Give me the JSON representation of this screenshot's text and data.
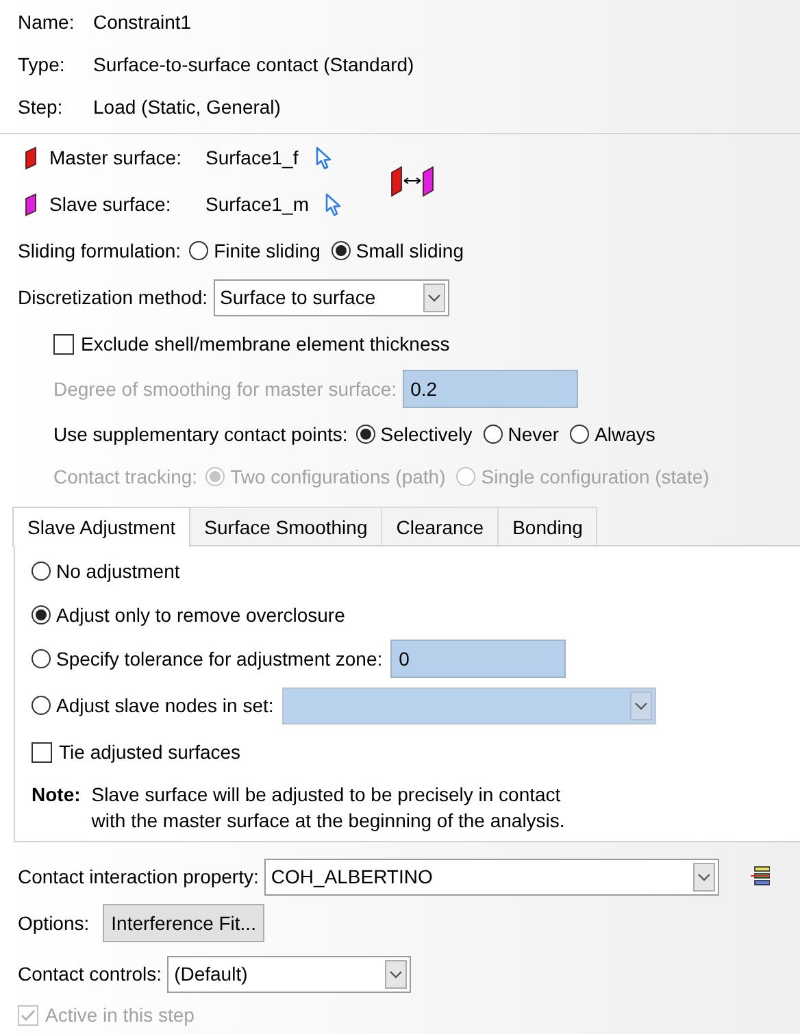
{
  "header": [
    {
      "label": "Name:",
      "value": "Constraint1"
    },
    {
      "label": "Type:",
      "value": "Surface-to-surface contact (Standard)"
    },
    {
      "label": "Step:",
      "value": "Load (Static, General)"
    }
  ],
  "surfaces": [
    {
      "kind": "master",
      "label": "Master surface:",
      "value": "Surface1_f"
    },
    {
      "kind": "slave",
      "label": "Slave surface:",
      "value": "Surface1_m"
    }
  ],
  "sliding_formulation": {
    "label": "Sliding formulation:",
    "options": [
      {
        "label": "Finite sliding",
        "selected": false
      },
      {
        "label": "Small sliding",
        "selected": true
      }
    ]
  },
  "discretization": {
    "label": "Discretization method:",
    "value": "Surface to surface"
  },
  "exclude_thickness": {
    "label": "Exclude shell/membrane element thickness",
    "checked": false
  },
  "smoothing": {
    "label": "Degree of smoothing for master surface:",
    "value": "0.2",
    "disabled": true
  },
  "supplementary_points": {
    "label": "Use supplementary contact points:",
    "disabled": false,
    "options": [
      {
        "label": "Selectively",
        "selected": true
      },
      {
        "label": "Never",
        "selected": false
      },
      {
        "label": "Always",
        "selected": false
      }
    ]
  },
  "contact_tracking": {
    "label": "Contact tracking:",
    "disabled": true,
    "options": [
      {
        "label": "Two configurations (path)",
        "selected": true
      },
      {
        "label": "Single configuration (state)",
        "selected": false
      }
    ]
  },
  "tabs": [
    {
      "label": "Slave Adjustment",
      "selected": true
    },
    {
      "label": "Surface Smoothing",
      "selected": false
    },
    {
      "label": "Clearance",
      "selected": false
    },
    {
      "label": "Bonding",
      "selected": false
    }
  ],
  "adjustment_options": [
    {
      "kind": "plain",
      "label": "No adjustment",
      "selected": false
    },
    {
      "kind": "plain",
      "label": "Adjust only to remove overclosure",
      "selected": true
    },
    {
      "kind": "field",
      "label": "Specify tolerance for adjustment zone:",
      "selected": false,
      "value": "0"
    },
    {
      "kind": "dropdown",
      "label": "Adjust slave nodes in set:",
      "selected": false
    }
  ],
  "tie_adjusted": {
    "label": "Tie adjusted surfaces",
    "checked": false
  },
  "note": {
    "label": "Note:",
    "lines": [
      "Slave surface will be adjusted to be precisely in contact",
      "with the master surface at the beginning of the analysis."
    ]
  },
  "interaction_property": {
    "label": "Contact interaction property:",
    "value": "COH_ALBERTINO"
  },
  "options": {
    "label": "Options:",
    "button": "Interference Fit..."
  },
  "contact_controls": {
    "label": "Contact controls:",
    "value": "(Default)"
  },
  "active": {
    "label": "Active in this step",
    "checked": true,
    "disabled": true
  }
}
